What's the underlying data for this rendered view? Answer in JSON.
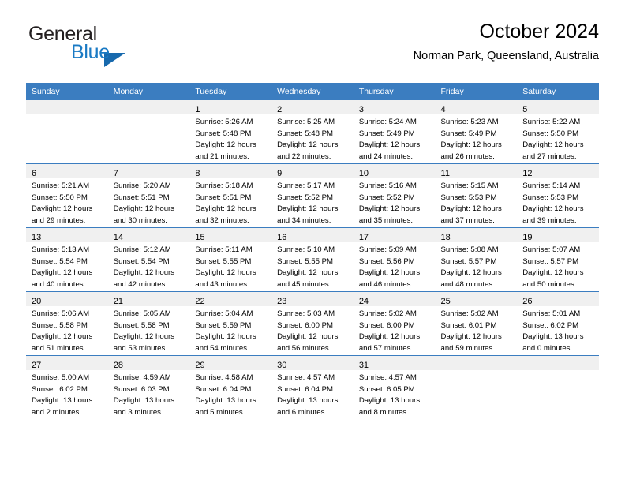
{
  "brand": {
    "general": "General",
    "blue": "Blue",
    "flag_color": "#1769ad"
  },
  "header": {
    "title": "October 2024",
    "subtitle": "Norman Park, Queensland, Australia"
  },
  "colors": {
    "header_blue": "#3b7dc0",
    "daynum_band": "#f0f0f0",
    "text": "#000000"
  },
  "weekday_headers": [
    "Sunday",
    "Monday",
    "Tuesday",
    "Wednesday",
    "Thursday",
    "Friday",
    "Saturday"
  ],
  "weeks": [
    [
      {
        "empty": true
      },
      {
        "empty": true
      },
      {
        "day": "1",
        "sunrise": "Sunrise: 5:26 AM",
        "sunset": "Sunset: 5:48 PM",
        "daylight1": "Daylight: 12 hours",
        "daylight2": "and 21 minutes."
      },
      {
        "day": "2",
        "sunrise": "Sunrise: 5:25 AM",
        "sunset": "Sunset: 5:48 PM",
        "daylight1": "Daylight: 12 hours",
        "daylight2": "and 22 minutes."
      },
      {
        "day": "3",
        "sunrise": "Sunrise: 5:24 AM",
        "sunset": "Sunset: 5:49 PM",
        "daylight1": "Daylight: 12 hours",
        "daylight2": "and 24 minutes."
      },
      {
        "day": "4",
        "sunrise": "Sunrise: 5:23 AM",
        "sunset": "Sunset: 5:49 PM",
        "daylight1": "Daylight: 12 hours",
        "daylight2": "and 26 minutes."
      },
      {
        "day": "5",
        "sunrise": "Sunrise: 5:22 AM",
        "sunset": "Sunset: 5:50 PM",
        "daylight1": "Daylight: 12 hours",
        "daylight2": "and 27 minutes."
      }
    ],
    [
      {
        "day": "6",
        "sunrise": "Sunrise: 5:21 AM",
        "sunset": "Sunset: 5:50 PM",
        "daylight1": "Daylight: 12 hours",
        "daylight2": "and 29 minutes."
      },
      {
        "day": "7",
        "sunrise": "Sunrise: 5:20 AM",
        "sunset": "Sunset: 5:51 PM",
        "daylight1": "Daylight: 12 hours",
        "daylight2": "and 30 minutes."
      },
      {
        "day": "8",
        "sunrise": "Sunrise: 5:18 AM",
        "sunset": "Sunset: 5:51 PM",
        "daylight1": "Daylight: 12 hours",
        "daylight2": "and 32 minutes."
      },
      {
        "day": "9",
        "sunrise": "Sunrise: 5:17 AM",
        "sunset": "Sunset: 5:52 PM",
        "daylight1": "Daylight: 12 hours",
        "daylight2": "and 34 minutes."
      },
      {
        "day": "10",
        "sunrise": "Sunrise: 5:16 AM",
        "sunset": "Sunset: 5:52 PM",
        "daylight1": "Daylight: 12 hours",
        "daylight2": "and 35 minutes."
      },
      {
        "day": "11",
        "sunrise": "Sunrise: 5:15 AM",
        "sunset": "Sunset: 5:53 PM",
        "daylight1": "Daylight: 12 hours",
        "daylight2": "and 37 minutes."
      },
      {
        "day": "12",
        "sunrise": "Sunrise: 5:14 AM",
        "sunset": "Sunset: 5:53 PM",
        "daylight1": "Daylight: 12 hours",
        "daylight2": "and 39 minutes."
      }
    ],
    [
      {
        "day": "13",
        "sunrise": "Sunrise: 5:13 AM",
        "sunset": "Sunset: 5:54 PM",
        "daylight1": "Daylight: 12 hours",
        "daylight2": "and 40 minutes."
      },
      {
        "day": "14",
        "sunrise": "Sunrise: 5:12 AM",
        "sunset": "Sunset: 5:54 PM",
        "daylight1": "Daylight: 12 hours",
        "daylight2": "and 42 minutes."
      },
      {
        "day": "15",
        "sunrise": "Sunrise: 5:11 AM",
        "sunset": "Sunset: 5:55 PM",
        "daylight1": "Daylight: 12 hours",
        "daylight2": "and 43 minutes."
      },
      {
        "day": "16",
        "sunrise": "Sunrise: 5:10 AM",
        "sunset": "Sunset: 5:55 PM",
        "daylight1": "Daylight: 12 hours",
        "daylight2": "and 45 minutes."
      },
      {
        "day": "17",
        "sunrise": "Sunrise: 5:09 AM",
        "sunset": "Sunset: 5:56 PM",
        "daylight1": "Daylight: 12 hours",
        "daylight2": "and 46 minutes."
      },
      {
        "day": "18",
        "sunrise": "Sunrise: 5:08 AM",
        "sunset": "Sunset: 5:57 PM",
        "daylight1": "Daylight: 12 hours",
        "daylight2": "and 48 minutes."
      },
      {
        "day": "19",
        "sunrise": "Sunrise: 5:07 AM",
        "sunset": "Sunset: 5:57 PM",
        "daylight1": "Daylight: 12 hours",
        "daylight2": "and 50 minutes."
      }
    ],
    [
      {
        "day": "20",
        "sunrise": "Sunrise: 5:06 AM",
        "sunset": "Sunset: 5:58 PM",
        "daylight1": "Daylight: 12 hours",
        "daylight2": "and 51 minutes."
      },
      {
        "day": "21",
        "sunrise": "Sunrise: 5:05 AM",
        "sunset": "Sunset: 5:58 PM",
        "daylight1": "Daylight: 12 hours",
        "daylight2": "and 53 minutes."
      },
      {
        "day": "22",
        "sunrise": "Sunrise: 5:04 AM",
        "sunset": "Sunset: 5:59 PM",
        "daylight1": "Daylight: 12 hours",
        "daylight2": "and 54 minutes."
      },
      {
        "day": "23",
        "sunrise": "Sunrise: 5:03 AM",
        "sunset": "Sunset: 6:00 PM",
        "daylight1": "Daylight: 12 hours",
        "daylight2": "and 56 minutes."
      },
      {
        "day": "24",
        "sunrise": "Sunrise: 5:02 AM",
        "sunset": "Sunset: 6:00 PM",
        "daylight1": "Daylight: 12 hours",
        "daylight2": "and 57 minutes."
      },
      {
        "day": "25",
        "sunrise": "Sunrise: 5:02 AM",
        "sunset": "Sunset: 6:01 PM",
        "daylight1": "Daylight: 12 hours",
        "daylight2": "and 59 minutes."
      },
      {
        "day": "26",
        "sunrise": "Sunrise: 5:01 AM",
        "sunset": "Sunset: 6:02 PM",
        "daylight1": "Daylight: 13 hours",
        "daylight2": "and 0 minutes."
      }
    ],
    [
      {
        "day": "27",
        "sunrise": "Sunrise: 5:00 AM",
        "sunset": "Sunset: 6:02 PM",
        "daylight1": "Daylight: 13 hours",
        "daylight2": "and 2 minutes."
      },
      {
        "day": "28",
        "sunrise": "Sunrise: 4:59 AM",
        "sunset": "Sunset: 6:03 PM",
        "daylight1": "Daylight: 13 hours",
        "daylight2": "and 3 minutes."
      },
      {
        "day": "29",
        "sunrise": "Sunrise: 4:58 AM",
        "sunset": "Sunset: 6:04 PM",
        "daylight1": "Daylight: 13 hours",
        "daylight2": "and 5 minutes."
      },
      {
        "day": "30",
        "sunrise": "Sunrise: 4:57 AM",
        "sunset": "Sunset: 6:04 PM",
        "daylight1": "Daylight: 13 hours",
        "daylight2": "and 6 minutes."
      },
      {
        "day": "31",
        "sunrise": "Sunrise: 4:57 AM",
        "sunset": "Sunset: 6:05 PM",
        "daylight1": "Daylight: 13 hours",
        "daylight2": "and 8 minutes."
      },
      {
        "empty": true
      },
      {
        "empty": true
      }
    ]
  ]
}
